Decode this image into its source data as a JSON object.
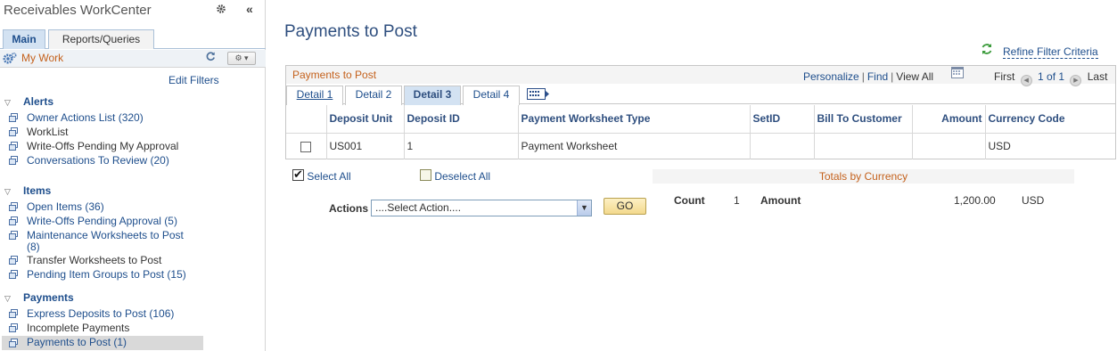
{
  "left": {
    "title": "Receivables WorkCenter",
    "tabs": [
      "Main",
      "Reports/Queries"
    ],
    "my_work_label": "My Work",
    "edit_filters": "Edit Filters",
    "groups": [
      {
        "label": "Alerts",
        "items": [
          "Owner Actions List (320)",
          "WorkList",
          "Write-Offs Pending My Approval",
          "Conversations To Review (20)"
        ]
      },
      {
        "label": "Items",
        "items": [
          "Open Items (36)",
          "Write-Offs Pending Approval (5)",
          "Maintenance Worksheets to Post (8)",
          "Transfer Worksheets to Post",
          "Pending Item Groups to Post (15)"
        ]
      },
      {
        "label": "Payments",
        "items": [
          "Express Deposits to Post (106)",
          "Incomplete Payments",
          "Payments to Post (1)"
        ]
      }
    ]
  },
  "main": {
    "page_title": "Payments to Post",
    "refine_label": "Refine Filter Criteria",
    "grid": {
      "title": "Payments to Post",
      "personalize": "Personalize",
      "find": "Find",
      "view_all": "View All",
      "first": "First",
      "page_info": "1 of 1",
      "last": "Last",
      "tabs": [
        "Detail 1",
        "Detail 2",
        "Detail 3",
        "Detail 4"
      ],
      "columns": [
        "Deposit Unit",
        "Deposit ID",
        "Payment Worksheet Type",
        "SetID",
        "Bill To Customer",
        "Amount",
        "Currency Code"
      ],
      "rows": [
        [
          "US001",
          "1",
          "Payment Worksheet",
          "",
          "",
          "",
          "USD"
        ]
      ]
    },
    "select_all": "Select All",
    "deselect_all": "Deselect All",
    "actions_label": "Actions",
    "actions_value": "....Select Action....",
    "go_label": "GO",
    "totals": {
      "title": "Totals by Currency",
      "count_label": "Count",
      "count_value": "1",
      "amount_label": "Amount",
      "amount_value": "1,200.00",
      "currency": "USD"
    }
  },
  "colors": {
    "accent_blue": "#1e4e8c",
    "title_orange": "#c4611c",
    "tab_active": "#d3e2f2"
  }
}
